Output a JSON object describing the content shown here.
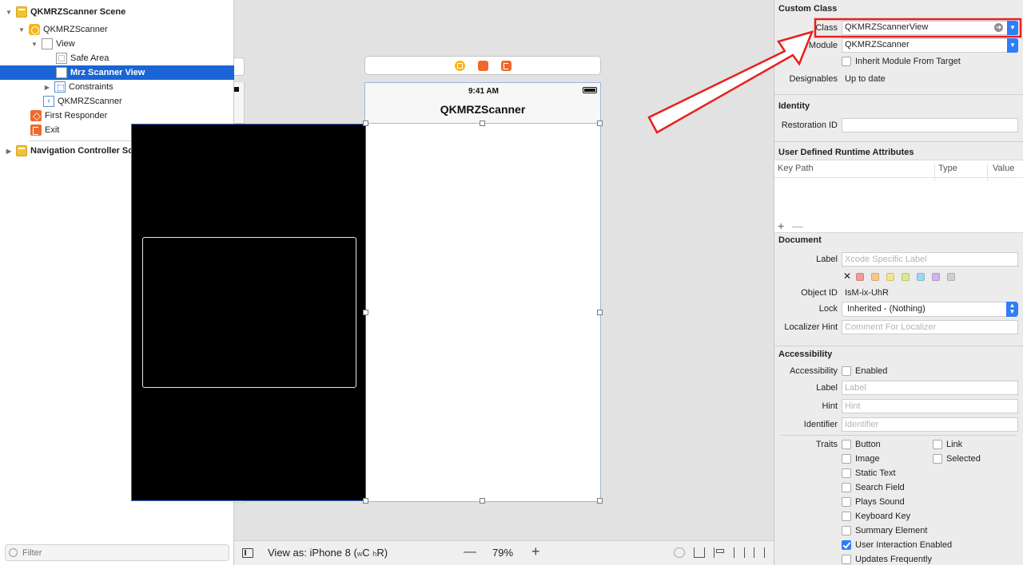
{
  "navigator": {
    "items": [
      {
        "label": "QKMRZScanner Scene"
      },
      {
        "label": "QKMRZScanner"
      },
      {
        "label": "View"
      },
      {
        "label": "Safe Area"
      },
      {
        "label": "Mrz Scanner View"
      },
      {
        "label": "Constraints"
      },
      {
        "label": "QKMRZScanner"
      },
      {
        "label": "First Responder"
      },
      {
        "label": "Exit"
      },
      {
        "label": "Navigation Controller Scene"
      }
    ],
    "filter_placeholder": "Filter"
  },
  "canvas": {
    "status_time": "9:41 AM",
    "nav_title": "QKMRZScanner"
  },
  "toolbar": {
    "view_as_prefix": "View as: iPhone 8 (",
    "size_w": "w",
    "size_c": "C",
    "size_h": "h",
    "size_r": "R)",
    "zoom_out": "—",
    "zoom_level": "79%",
    "zoom_in": "+"
  },
  "inspector": {
    "custom_class": {
      "title": "Custom Class",
      "class_label": "Class",
      "class_value": "QKMRZScannerView",
      "module_label": "Module",
      "module_value": "QKMRZScanner",
      "inherit_label": "Inherit Module From Target",
      "designables_label": "Designables",
      "designables_value": "Up to date"
    },
    "identity": {
      "title": "Identity",
      "restoration_label": "Restoration ID",
      "restoration_value": ""
    },
    "runtime_attributes": {
      "title": "User Defined Runtime Attributes",
      "columns": [
        "Key Path",
        "Type",
        "Value"
      ],
      "add": "+",
      "remove": "—"
    },
    "document": {
      "title": "Document",
      "label_label": "Label",
      "label_placeholder": "Xcode Specific Label",
      "swatch_none": "✕",
      "swatch_colors": [
        "#f19a9a",
        "#f6c98b",
        "#f3e58b",
        "#d6ec8e",
        "#9dd6f3",
        "#d0b3ef",
        "#cfcfcf"
      ],
      "object_id_label": "Object ID",
      "object_id_value": "IsM-ix-UhR",
      "lock_label": "Lock",
      "lock_value": "Inherited - (Nothing)",
      "localizer_label": "Localizer Hint",
      "localizer_placeholder": "Comment For Localizer"
    },
    "accessibility": {
      "title": "Accessibility",
      "accessibility_label": "Accessibility",
      "enabled_label": "Enabled",
      "label_label": "Label",
      "label_placeholder": "Label",
      "hint_label": "Hint",
      "hint_placeholder": "Hint",
      "identifier_label": "Identifier",
      "identifier_placeholder": "Identifier",
      "traits_label": "Traits",
      "traits": [
        {
          "label": "Button",
          "checked": false
        },
        {
          "label": "Link",
          "checked": false
        },
        {
          "label": "Image",
          "checked": false
        },
        {
          "label": "Selected",
          "checked": false
        },
        {
          "label": "Static Text",
          "checked": false
        },
        {
          "label": "Search Field",
          "checked": false
        },
        {
          "label": "Plays Sound",
          "checked": false
        },
        {
          "label": "Keyboard Key",
          "checked": false
        },
        {
          "label": "Summary Element",
          "checked": false
        },
        {
          "label": "User Interaction Enabled",
          "checked": true
        },
        {
          "label": "Updates Frequently",
          "checked": false
        }
      ]
    }
  },
  "colors": {
    "selection": "#1a64d6",
    "accent": "#2d7ef7",
    "annotation": "#e8201c"
  }
}
